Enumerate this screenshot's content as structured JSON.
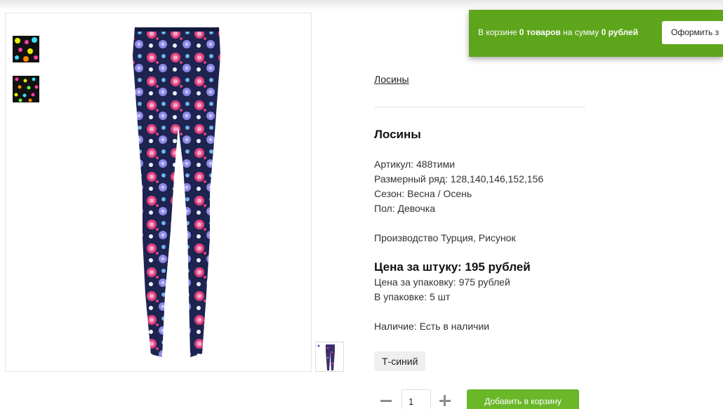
{
  "cart": {
    "prefix": "В корзине ",
    "count": "0 товаров",
    "middle": " на сумму ",
    "sum": "0 рублей",
    "checkout_label": "Оформить з"
  },
  "breadcrumb": "Лосины",
  "product": {
    "title": "Лосины",
    "article": "Артикул: 488тими",
    "sizes": "Размерный ряд: 128,140,146,152,156",
    "season": "Сезон: Весна / Осень",
    "gender": "Пол: Девочка",
    "production": "Производство Турция, Рисунок",
    "price_unit": "Цена за штуку: 195 рублей",
    "price_pack": "Цена за упаковку: 975 рублей",
    "pack_size": "В упаковке: 5 шт",
    "availability": "Наличие: Есть в наличии",
    "color_option": "Т-синий"
  },
  "purchase": {
    "quantity": "1",
    "add_label": "Добавить в корзину"
  },
  "colors": {
    "cart_green": "#5da51b",
    "button_green": "#6ab72a",
    "legging_navy": "#1d2450",
    "rose_pink": "#e0407e"
  },
  "icons": [
    "minus-icon",
    "plus-icon"
  ]
}
